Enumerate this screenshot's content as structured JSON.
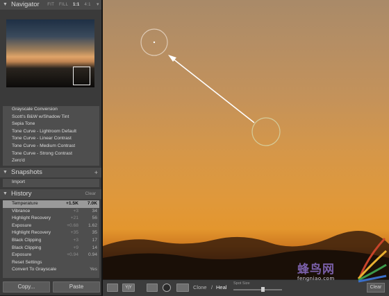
{
  "navigator": {
    "title": "Navigator",
    "zoom_options": [
      "FIT",
      "FILL",
      "1:1",
      "4:1"
    ],
    "zoom_selected": "1:1",
    "menu_arrow": "▼"
  },
  "presets": {
    "items": [
      "Grayscale Conversion",
      "Scott's B&W w/Shadow Tint",
      "Sepia Tone",
      "Tone Curve - Lightroom Default",
      "Tone Curve - Linear Contrast",
      "Tone Curve - Medium Contrast",
      "Tone Curve - Strong Contrast",
      "Zero'd"
    ]
  },
  "snapshots": {
    "title": "Snapshots",
    "add_label": "+",
    "items": [
      "Import"
    ]
  },
  "history": {
    "title": "History",
    "clear_label": "Clear",
    "items": [
      {
        "label": "Temperature",
        "delta": "+1.5K",
        "value": "7.0K",
        "selected": true
      },
      {
        "label": "Vibrance",
        "delta": "+3",
        "value": "34"
      },
      {
        "label": "Highlight Recovery",
        "delta": "+21",
        "value": "56"
      },
      {
        "label": "Exposure",
        "delta": "+0.68",
        "value": "1.62"
      },
      {
        "label": "Highlight Recovery",
        "delta": "+35",
        "value": "35"
      },
      {
        "label": "Black Clipping",
        "delta": "+3",
        "value": "17"
      },
      {
        "label": "Black Clipping",
        "delta": "+9",
        "value": "14"
      },
      {
        "label": "Exposure",
        "delta": "+0.94",
        "value": "0.94"
      },
      {
        "label": "Reset Settings",
        "delta": "",
        "value": ""
      },
      {
        "label": "Convert To Grayscale",
        "delta": "",
        "value": "Yes"
      }
    ]
  },
  "bottom_buttons": {
    "copy": "Copy...",
    "paste": "Paste"
  },
  "toolbar": {
    "clone_label": "Clone",
    "separator": "/",
    "heal_label": "Heal",
    "spot_size_label": "Spot Size",
    "clear_label": "Clear",
    "yy_label": "Y|Y"
  },
  "watermark": {
    "title": "蜂鸟网",
    "url": "fengniao.com"
  },
  "icons": {
    "panel_triangle": "down-triangle-icon",
    "loupe_view": "loupe-view-icon",
    "before_after": "before-after-icon",
    "crop": "crop-icon",
    "spot_removal": "spot-removal-icon",
    "gradient": "gradient-icon"
  }
}
